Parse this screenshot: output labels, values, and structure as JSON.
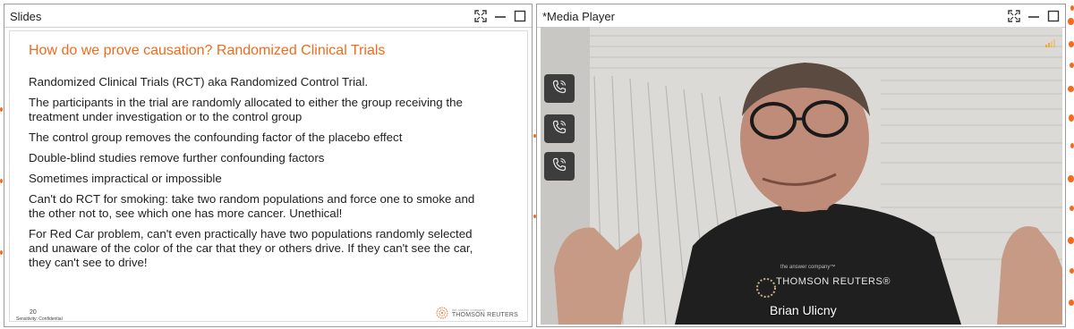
{
  "slides_pane": {
    "title": "Slides",
    "slide": {
      "heading": "How do we prove causation?  Randomized Clinical Trials",
      "bullets": [
        "Randomized Clinical Trials (RCT)  aka Randomized Control Trial.",
        "The participants in the trial are randomly allocated to either the group receiving the treatment under investigation or to the control group",
        "The control group removes the confounding factor of the placebo effect",
        "Double-blind studies remove further confounding factors",
        "Sometimes impractical or impossible",
        "Can't do RCT for smoking: take two random populations and force one to smoke and the other not to, see which one has more cancer.  Unethical!",
        "For Red Car problem, can't even practically have two populations randomly selected and unaware of the color of the car that they or others drive.  If they can't see the car, they can't see to drive!"
      ],
      "slide_number": "20",
      "sensitivity": "Sensitivity: Confidential",
      "brand_tagline": "the answer company",
      "brand_name": "THOMSON REUTERS"
    }
  },
  "media_pane": {
    "title": "*Media Player",
    "speaker_name": "Brian Ulicny",
    "shirt_tagline": "the answer company™",
    "shirt_brand": "THOMSON REUTERS®",
    "call_buttons": [
      "phone-icon",
      "phone-icon",
      "phone-icon"
    ]
  },
  "window_controls": [
    "expand-icon",
    "minimize-icon",
    "maximize-icon"
  ],
  "colors": {
    "accent": "#f26a1b",
    "signal": "#f5a623",
    "call_button_bg": "#3d3d3d"
  }
}
